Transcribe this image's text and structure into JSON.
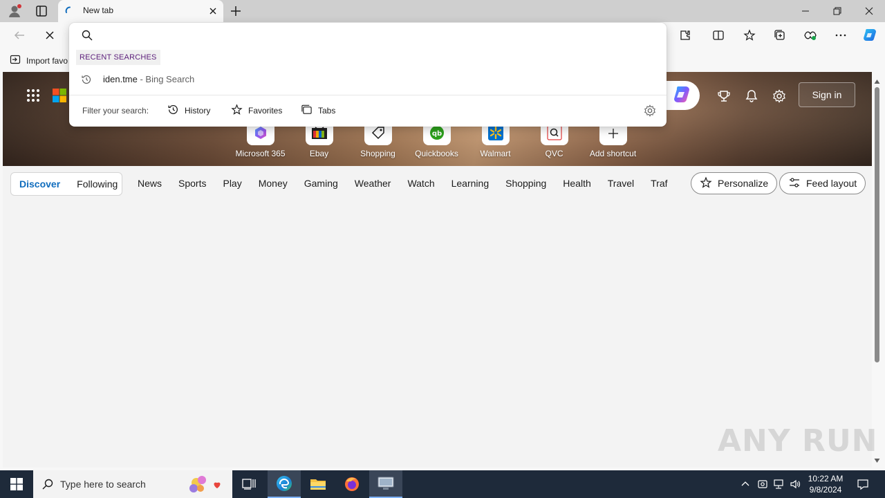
{
  "browser": {
    "tab": {
      "title": "New tab"
    },
    "favorites_bar": {
      "import_label": "Import favo"
    }
  },
  "omnibox": {
    "input_value": "",
    "recent_header": "RECENT SEARCHES",
    "recent": [
      {
        "query": "iden.tme",
        "source": " - Bing Search"
      }
    ],
    "filter_label": "Filter your search:",
    "filters": [
      "History",
      "Favorites",
      "Tabs"
    ]
  },
  "newtab": {
    "signin_label": "Sign in",
    "shortcuts": [
      {
        "label": "Microsoft 365",
        "icon": "microsoft-365-icon"
      },
      {
        "label": "Ebay",
        "icon": "ebay-icon"
      },
      {
        "label": "Shopping",
        "icon": "shopping-tag-icon"
      },
      {
        "label": "Quickbooks",
        "icon": "quickbooks-icon"
      },
      {
        "label": "Walmart",
        "icon": "walmart-icon"
      },
      {
        "label": "QVC",
        "icon": "qvc-icon"
      },
      {
        "label": "Add shortcut",
        "icon": "plus-icon"
      }
    ],
    "feed_tabs": [
      "Discover",
      "Following"
    ],
    "categories": [
      "News",
      "Sports",
      "Play",
      "Money",
      "Gaming",
      "Weather",
      "Watch",
      "Learning",
      "Shopping",
      "Health",
      "Travel",
      "Traf"
    ],
    "personalize_label": "Personalize",
    "feed_layout_label": "Feed layout"
  },
  "watermark": "ANY RUN",
  "taskbar": {
    "search_placeholder": "Type here to search",
    "time": "10:22 AM",
    "date": "9/8/2024"
  },
  "colors": {
    "accent": "#0f6cbd",
    "taskbar": "#1e2a3a",
    "recent_header_text": "#5b1d7a"
  }
}
